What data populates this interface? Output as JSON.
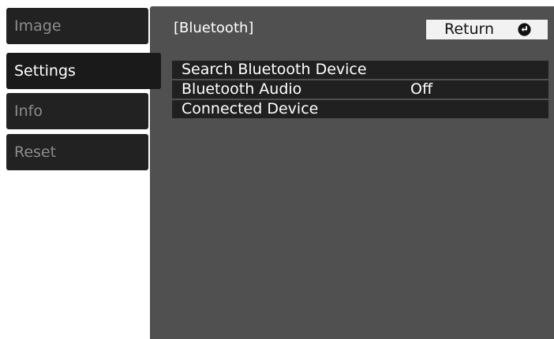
{
  "sidebar": {
    "tabs": [
      {
        "label": "Image",
        "active": false
      },
      {
        "label": "Settings",
        "active": true
      },
      {
        "label": "Info",
        "active": false
      },
      {
        "label": "Reset",
        "active": false
      }
    ]
  },
  "panel": {
    "title": "[Bluetooth]",
    "return_label": "Return",
    "return_icon": "enter-return-icon"
  },
  "menu": {
    "items": [
      {
        "label": "Search Bluetooth Device",
        "value": ""
      },
      {
        "label": "Bluetooth Audio",
        "value": "Off"
      },
      {
        "label": "Connected Device",
        "value": ""
      }
    ]
  },
  "colors": {
    "panel_bg": "#505050",
    "tab_bg": "#222222",
    "menu_item_bg": "#202020",
    "button_bg": "#f2f2f2",
    "inactive_text": "#8c8c8c",
    "active_text": "#ffffff"
  }
}
